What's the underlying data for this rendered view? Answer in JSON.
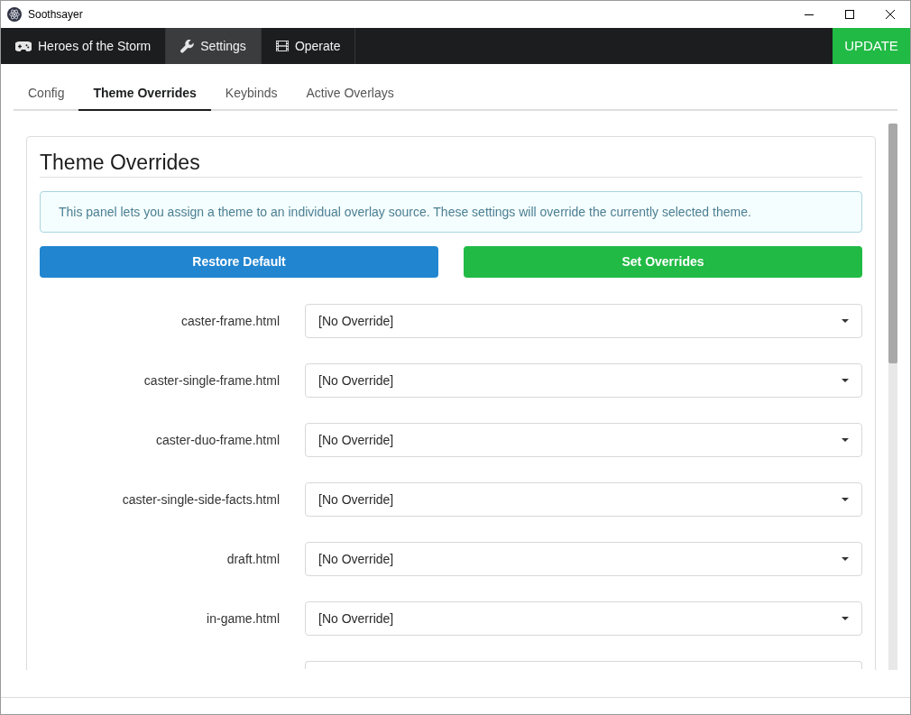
{
  "window": {
    "title": "Soothsayer"
  },
  "nav": {
    "items": [
      {
        "label": "Heroes of the Storm",
        "selected": false
      },
      {
        "label": "Settings",
        "selected": true
      },
      {
        "label": "Operate",
        "selected": false
      }
    ],
    "update_button": "UPDATE"
  },
  "tabs": [
    {
      "label": "Config",
      "selected": false
    },
    {
      "label": "Theme Overrides",
      "selected": true
    },
    {
      "label": "Keybinds",
      "selected": false
    },
    {
      "label": "Active Overlays",
      "selected": false
    }
  ],
  "panel": {
    "title": "Theme Overrides",
    "info": "This panel lets you assign a theme to an individual overlay source. These settings will override the currently selected theme.",
    "buttons": [
      {
        "label": "Restore Default",
        "kind": "primary"
      },
      {
        "label": "Set Overrides",
        "kind": "positive"
      }
    ],
    "overrides": [
      {
        "kind": "select",
        "label": "caster-frame.html",
        "value": "[No Override]"
      },
      {
        "kind": "select",
        "label": "caster-single-frame.html",
        "value": "[No Override]"
      },
      {
        "kind": "select",
        "label": "caster-duo-frame.html",
        "value": "[No Override]"
      },
      {
        "kind": "select",
        "label": "caster-single-side-facts.html",
        "value": "[No Override]"
      },
      {
        "kind": "select",
        "label": "draft.html",
        "value": "[No Override]"
      },
      {
        "kind": "select",
        "label": "in-game.html",
        "value": "[No Override]"
      },
      {
        "kind": "clipped"
      }
    ]
  }
}
